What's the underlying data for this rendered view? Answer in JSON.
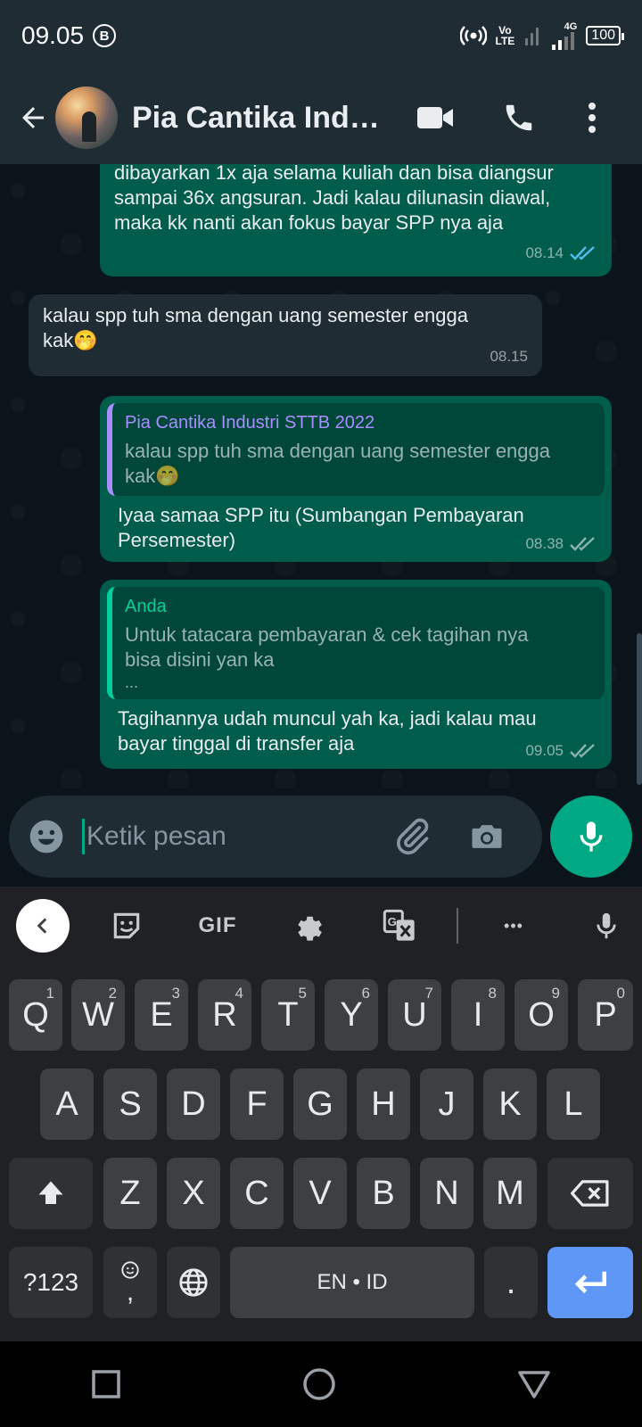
{
  "status_bar": {
    "time": "09.05",
    "b_badge": "B",
    "volte_top": "Vo",
    "volte_bottom": "LTE",
    "network": "4G",
    "battery": "100"
  },
  "header": {
    "title": "Pia Cantika Indu…"
  },
  "messages": {
    "m1": {
      "lines": [
        "dibayarkan 1x aja selama kuliah dan bisa diangsur",
        "sampai 36x angsuran. Jadi kalau dilunasin diawal,",
        "maka kk nanti akan fokus bayar SPP nya aja"
      ],
      "time": "08.14"
    },
    "m2": {
      "text1": "kalau spp tuh sma dengan uang semester engga",
      "text2": "kak",
      "emoji": "🤭",
      "time": "08.15"
    },
    "m3": {
      "quote_author": "Pia Cantika Industri STTB 2022",
      "quote_text1": "kalau spp tuh sma dengan uang semester engga",
      "quote_text2": "kak",
      "quote_emoji": "🤭",
      "text1": "Iyaa samaa SPP itu (Sumbangan Pembayaran",
      "text2": "Persemester)",
      "time": "08.38"
    },
    "m4": {
      "quote_author": "Anda",
      "quote_text1": "Untuk tatacara pembayaran & cek tagihan nya",
      "quote_text2": "bisa disini yan ka",
      "quote_text3": "...",
      "text1": "Tagihannya udah muncul yah ka, jadi kalau mau",
      "text2": "bayar tinggal di transfer aja",
      "time": "09.05"
    }
  },
  "composer": {
    "placeholder": "Ketik pesan"
  },
  "keyboard": {
    "toolbar": {
      "gif": "GIF",
      "more": "•••"
    },
    "row1": [
      {
        "k": "Q",
        "h": "1"
      },
      {
        "k": "W",
        "h": "2"
      },
      {
        "k": "E",
        "h": "3"
      },
      {
        "k": "R",
        "h": "4"
      },
      {
        "k": "T",
        "h": "5"
      },
      {
        "k": "Y",
        "h": "6"
      },
      {
        "k": "U",
        "h": "7"
      },
      {
        "k": "I",
        "h": "8"
      },
      {
        "k": "O",
        "h": "9"
      },
      {
        "k": "P",
        "h": "0"
      }
    ],
    "row2": [
      "A",
      "S",
      "D",
      "F",
      "G",
      "H",
      "J",
      "K",
      "L"
    ],
    "row3": [
      "Z",
      "X",
      "C",
      "V",
      "B",
      "N",
      "M"
    ],
    "sym_key": "?123",
    "comma_key": ",",
    "space_label": "EN • ID",
    "period_key": "."
  },
  "colors": {
    "accent": "#00a884",
    "bubble_out": "#005c4b",
    "bubble_in": "#1f2c34",
    "quote_purple": "#a98eff",
    "quote_green": "#06cf9c",
    "tick_blue": "#53bdeb"
  }
}
